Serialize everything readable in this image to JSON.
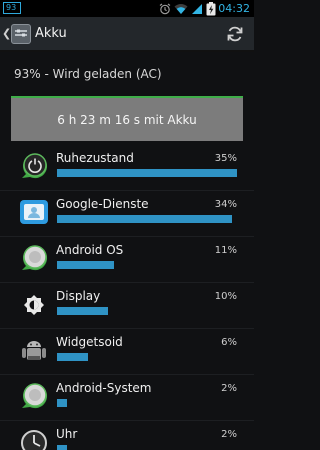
{
  "status_bar": {
    "battery_level": "93",
    "time": "04:32"
  },
  "header": {
    "title": "Akku",
    "refresh_icon": "refresh-icon"
  },
  "summary": {
    "status": "93% - Wird geladen (AC)"
  },
  "graph": {
    "duration": "6 h 23 m 16 s mit Akku",
    "line_color": "#3fae49"
  },
  "colors": {
    "accent": "#2f93c5",
    "status_blue": "#32b5e5"
  },
  "items": [
    {
      "label": "Ruhezustand",
      "percent": "35%",
      "value": 35,
      "icon": "power-icon"
    },
    {
      "label": "Google-Dienste",
      "percent": "34%",
      "value": 34,
      "icon": "google-services-icon"
    },
    {
      "label": "Android OS",
      "percent": "11%",
      "value": 11,
      "icon": "android-os-icon"
    },
    {
      "label": "Display",
      "percent": "10%",
      "value": 10,
      "icon": "brightness-icon"
    },
    {
      "label": "Widgetsoid",
      "percent": "6%",
      "value": 6,
      "icon": "widgetsoid-icon"
    },
    {
      "label": "Android-System",
      "percent": "2%",
      "value": 2,
      "icon": "android-system-icon"
    },
    {
      "label": "Uhr",
      "percent": "2%",
      "value": 2,
      "icon": "clock-icon"
    }
  ]
}
